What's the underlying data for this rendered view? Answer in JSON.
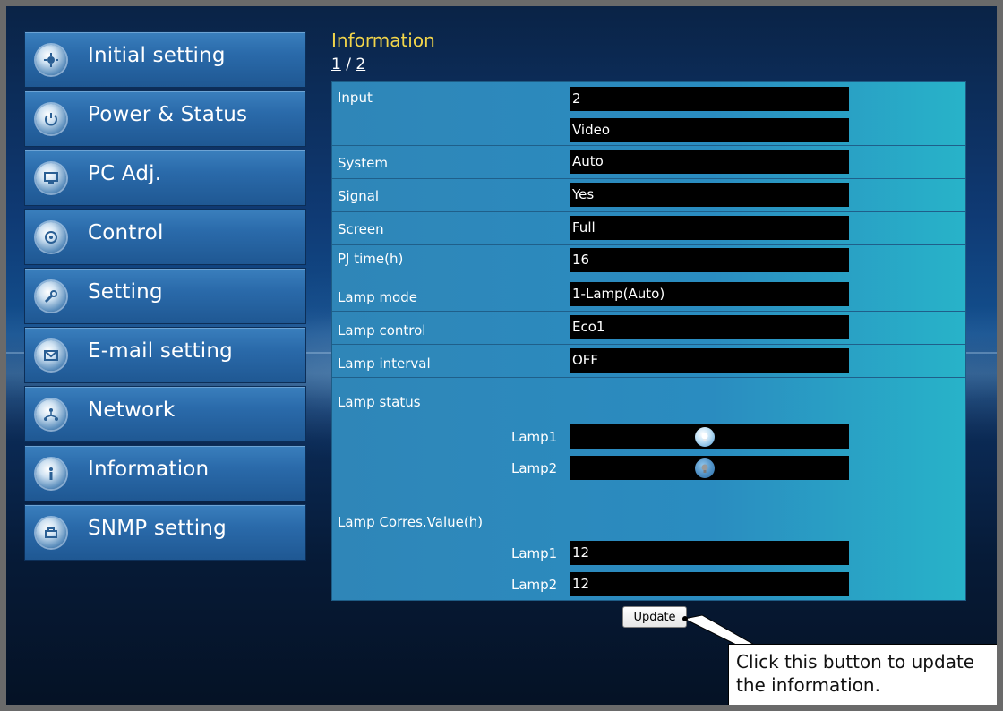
{
  "sidebar": {
    "items": [
      {
        "label": "Initial setting",
        "icon": "gear-icon"
      },
      {
        "label": "Power & Status",
        "icon": "power-icon"
      },
      {
        "label": "PC Adj.",
        "icon": "monitor-icon"
      },
      {
        "label": "Control",
        "icon": "control-icon"
      },
      {
        "label": "Setting",
        "icon": "wrench-icon"
      },
      {
        "label": "E-mail setting",
        "icon": "mail-icon"
      },
      {
        "label": "Network",
        "icon": "network-icon"
      },
      {
        "label": "Information",
        "icon": "info-icon"
      },
      {
        "label": "SNMP setting",
        "icon": "snmp-icon"
      }
    ]
  },
  "main": {
    "title": "Information",
    "page_current": "1",
    "page_sep": " / ",
    "page_next": "2",
    "rows": {
      "input": {
        "label": "Input",
        "value1": "2",
        "value2": "Video"
      },
      "system": {
        "label": "System",
        "value": "Auto"
      },
      "signal": {
        "label": "Signal",
        "value": "Yes"
      },
      "screen": {
        "label": "Screen",
        "value": "Full"
      },
      "pj_time": {
        "label": "PJ time(h)",
        "value": "16"
      },
      "lamp_mode": {
        "label": "Lamp mode",
        "value": "1-Lamp(Auto)"
      },
      "lamp_control": {
        "label": "Lamp control",
        "value": "Eco1"
      },
      "lamp_interval": {
        "label": "Lamp interval",
        "value": "OFF"
      },
      "lamp_status": {
        "label": "Lamp status",
        "lamp1_label": "Lamp1",
        "lamp1_state": "on",
        "lamp2_label": "Lamp2",
        "lamp2_state": "off"
      },
      "lamp_corres": {
        "label": "Lamp Corres.Value(h)",
        "lamp1_label": "Lamp1",
        "lamp1_value": "12",
        "lamp2_label": "Lamp2",
        "lamp2_value": "12"
      }
    },
    "update_label": "Update",
    "callout_text": "Click this button to update the information."
  },
  "colors": {
    "title": "#f2d54a",
    "panel": "#2f86b8",
    "value_bg": "#000000"
  }
}
